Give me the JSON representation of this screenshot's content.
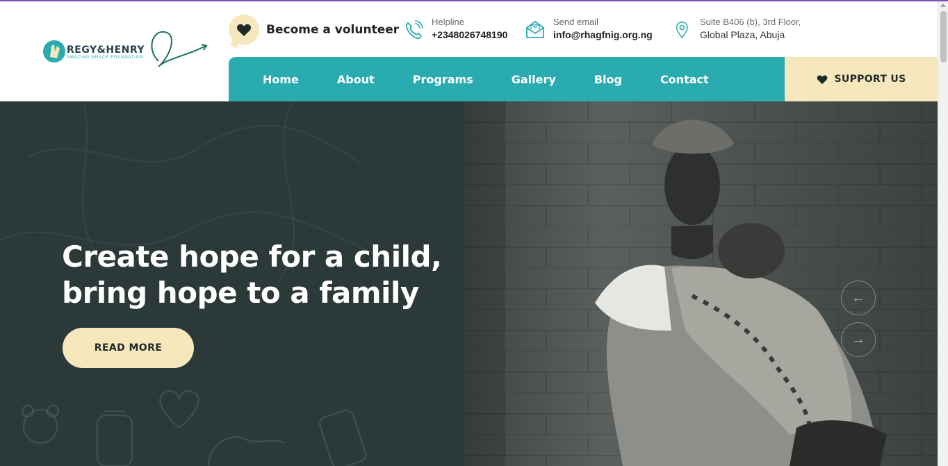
{
  "logo": {
    "brand": "REGY&HENRY",
    "tagline": "AMAZING GRACE FOUNDATION"
  },
  "volunteer": {
    "label": "Become a volunteer"
  },
  "contacts": {
    "helpline_label": "Helpline",
    "helpline_value": "+2348026748190",
    "email_label": "Send email",
    "email_value": "info@rhagfnig.org.ng",
    "address_line1": "Suite B406 (b), 3rd Floor,",
    "address_line2": "Global Plaza, Abuja"
  },
  "nav": {
    "items": [
      "Home",
      "About",
      "Programs",
      "Gallery",
      "Blog",
      "Contact"
    ]
  },
  "support": {
    "label": "SUPPORT US"
  },
  "hero": {
    "headline_line1": "Create hope for a child,",
    "headline_line2": "bring hope to a family",
    "cta": "READ MORE",
    "prev_icon": "arrow-left-icon",
    "next_icon": "arrow-right-icon"
  },
  "colors": {
    "teal": "#2aabb0",
    "cream": "#f6e7bd",
    "dark": "#2b3938",
    "accent_line": "#7a4fb0"
  }
}
